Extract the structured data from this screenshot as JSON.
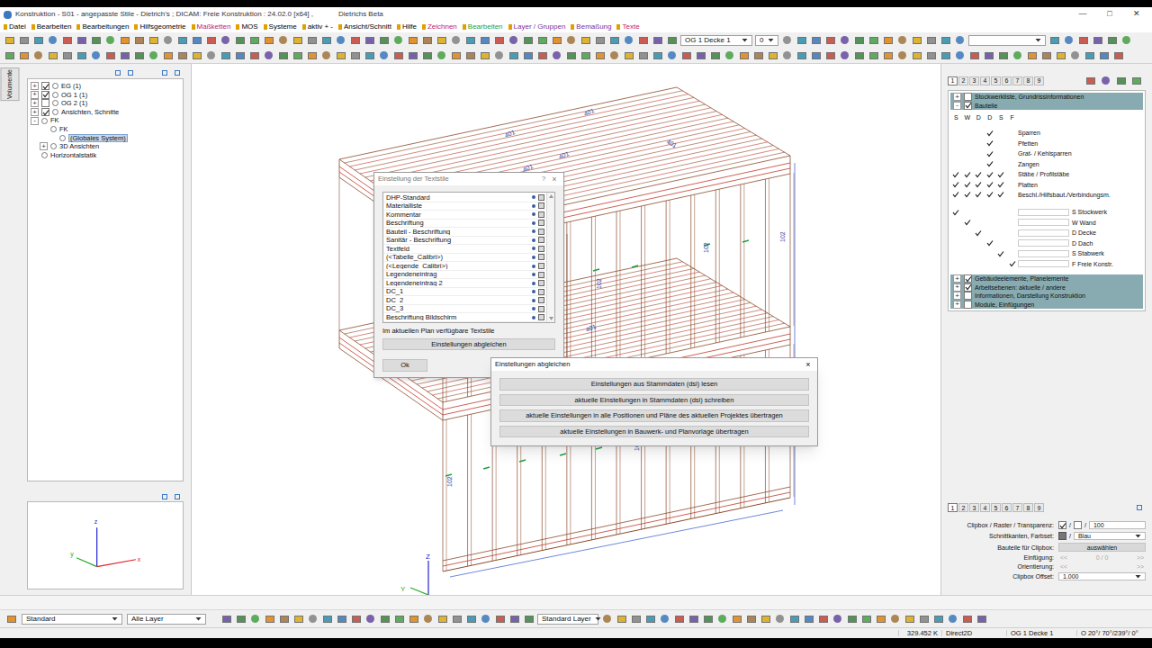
{
  "window": {
    "title": "Konstruktion - S01 - angepasste Stile - Dietrich's ; DICAM: Freie Konstruktion : 24.02.0 [x64] ,",
    "subtitle": "Dietrichs Beta",
    "controls": [
      "—",
      "□",
      "✕"
    ]
  },
  "menu": [
    {
      "label": "Datei",
      "color": "#000000"
    },
    {
      "label": "Bearbeiten",
      "color": "#000000"
    },
    {
      "label": "Bearbeitungen",
      "color": "#000000"
    },
    {
      "label": "Hilfsgeometrie",
      "color": "#000000"
    },
    {
      "label": "Maßketten",
      "color": "#c0186a"
    },
    {
      "label": "MOS",
      "color": "#000000"
    },
    {
      "label": "Systeme",
      "color": "#000000"
    },
    {
      "label": "aktiv + -",
      "color": "#000000"
    },
    {
      "label": "Ansicht/Schnitt",
      "color": "#000000"
    },
    {
      "label": "Hilfe",
      "color": "#000000"
    },
    {
      "label": "Zeichnen",
      "color": "#c0186a"
    },
    {
      "label": "Bearbeiten",
      "color": "#1a9e3a"
    },
    {
      "label": "Layer / Gruppen",
      "color": "#7b2fa0"
    },
    {
      "label": "Bemaßung",
      "color": "#7b2fa0"
    },
    {
      "label": "Texte",
      "color": "#c0186a"
    }
  ],
  "toolbar": {
    "floor_select": "OG 1 Decke 1",
    "floor_index": "0"
  },
  "left_panel": {
    "tab": "Volumente",
    "tree": [
      {
        "label": "EG (1)",
        "depth": 0,
        "expander": "+",
        "has_checkbox": true,
        "checked": true,
        "selected": false
      },
      {
        "label": "OG 1 (1)",
        "depth": 0,
        "expander": "+",
        "has_checkbox": true,
        "checked": true,
        "selected": false
      },
      {
        "label": "OG 2 (1)",
        "depth": 0,
        "expander": "+",
        "has_checkbox": true,
        "checked": false,
        "selected": false
      },
      {
        "label": "Ansichten, Schnitte",
        "depth": 0,
        "expander": "+",
        "has_checkbox": true,
        "checked": true,
        "selected": false
      },
      {
        "label": "FK",
        "depth": 0,
        "expander": "-",
        "has_checkbox": false,
        "checked": false,
        "selected": false
      },
      {
        "label": "FK",
        "depth": 1,
        "expander": "",
        "has_checkbox": false,
        "checked": false,
        "selected": false
      },
      {
        "label": "(Globales System)",
        "depth": 2,
        "expander": "",
        "has_checkbox": false,
        "checked": false,
        "selected": true
      },
      {
        "label": "3D Ansichten",
        "depth": 1,
        "expander": "+",
        "has_checkbox": false,
        "checked": false,
        "selected": false
      },
      {
        "label": "Horizontalstatik",
        "depth": 0,
        "expander": "",
        "has_checkbox": false,
        "checked": false,
        "selected": false
      }
    ],
    "axes": [
      "z",
      "y",
      "x"
    ]
  },
  "canvas": {
    "labels": [
      "401",
      "401",
      "401",
      "401",
      "401",
      "102",
      "102",
      "102",
      "401",
      "102",
      "102",
      "102"
    ],
    "axes": [
      "Z",
      "Y"
    ]
  },
  "textstyle_dialog": {
    "title": "Einstellung der Textstile",
    "help": "?",
    "close": "×",
    "styles": [
      "DHP-Standard",
      "Materialliste",
      "Kommentar",
      "Beschriftung",
      "Bauteil - Beschriftung",
      "Sanitär - Beschriftung",
      "Textfeld",
      "(<Tabelle_Calibri>)",
      "(<Legende_Calibri>)",
      "Legendeneintrag",
      "Legendeneintrag 2",
      "DC_1",
      "DC_2",
      "DC_3",
      "Beschriftung Bildschirm"
    ],
    "caption": "Im aktuellen Plan verfügbare Textstile",
    "sync_button": "Einstellungen abgleichen",
    "ok_button": "Ok"
  },
  "sync_dialog": {
    "title": "Einstellungen abgleichen",
    "close": "×",
    "buttons": [
      "Einstellungen aus Stammdaten (dsi) lesen",
      "aktuelle Einstellungen in Stammdaten (dsi) schreiben",
      "aktuelle Einstellungen in alle Positionen und Pläne des aktuellen Projektes übertragen",
      "aktuelle Einstellungen in Bauwerk- und Planvorlage übertragen"
    ]
  },
  "right_panel": {
    "tabs": [
      {
        "label": "1",
        "selected": true
      },
      {
        "label": "2",
        "selected": false
      },
      {
        "label": "3",
        "selected": false
      },
      {
        "label": "4",
        "selected": false
      },
      {
        "label": "5",
        "selected": false
      },
      {
        "label": "6",
        "selected": false
      },
      {
        "label": "7",
        "selected": false
      },
      {
        "label": "8",
        "selected": false
      },
      {
        "label": "9",
        "selected": false
      }
    ],
    "top_groups": [
      {
        "label": "Stockwerkliste, Grundrissinformationen",
        "expander": "+",
        "checked": false
      },
      {
        "label": "Bauteile",
        "expander": "-",
        "checked": true
      }
    ],
    "columns": [
      "S",
      "W",
      "D",
      "D",
      "S",
      "F"
    ],
    "parts": [
      {
        "label": "Sparren",
        "checks": [
          false,
          false,
          false,
          true,
          false,
          false
        ]
      },
      {
        "label": "Pfetten",
        "checks": [
          false,
          false,
          false,
          true,
          false,
          false
        ]
      },
      {
        "label": "Grat- / Kehlsparren",
        "checks": [
          false,
          false,
          false,
          true,
          false,
          false
        ]
      },
      {
        "label": "Zangen",
        "checks": [
          false,
          false,
          false,
          true,
          false,
          false
        ]
      },
      {
        "label": "Stäbe / Profilstäbe",
        "checks": [
          true,
          true,
          true,
          true,
          true,
          false
        ]
      },
      {
        "label": "Platten",
        "checks": [
          true,
          true,
          true,
          true,
          true,
          false
        ]
      },
      {
        "label": "Beschl./Hilfsbaut./Verbindungsm.",
        "checks": [
          true,
          true,
          true,
          true,
          true,
          false
        ]
      }
    ],
    "systems": [
      {
        "label": "S Stockwerk",
        "checks": [
          true,
          false,
          false,
          false,
          false,
          false
        ]
      },
      {
        "label": "W Wand",
        "checks": [
          false,
          true,
          false,
          false,
          false,
          false
        ]
      },
      {
        "label": "D Decke",
        "checks": [
          false,
          false,
          true,
          false,
          false,
          false
        ]
      },
      {
        "label": "D Dach",
        "checks": [
          false,
          false,
          false,
          true,
          false,
          false
        ]
      },
      {
        "label": "S Stabwerk",
        "checks": [
          false,
          false,
          false,
          false,
          true,
          false
        ]
      },
      {
        "label": "F Freie Konstr.",
        "checks": [
          false,
          false,
          false,
          false,
          false,
          true
        ]
      }
    ],
    "bottom_groups": [
      {
        "label": "Gebäudeelemente, Planelemente",
        "expander": "+",
        "checked": true
      },
      {
        "label": "Arbeitsebenen: aktuelle / andere",
        "expander": "+",
        "checked": true
      },
      {
        "label": "Informationen, Darstellung Konstruktion",
        "expander": "+",
        "checked": false
      },
      {
        "label": "Module, Einfügungen",
        "expander": "+",
        "checked": false
      }
    ],
    "prop_tabs": [
      {
        "label": "1",
        "selected": true
      },
      {
        "label": "2",
        "selected": false
      },
      {
        "label": "3",
        "selected": false
      },
      {
        "label": "4",
        "selected": false
      },
      {
        "label": "5",
        "selected": false
      },
      {
        "label": "6",
        "selected": false
      },
      {
        "label": "7",
        "selected": false
      },
      {
        "label": "8",
        "selected": false
      },
      {
        "label": "9",
        "selected": false
      }
    ],
    "props": {
      "clipbox_label": "Clipbox / Raster / Transparenz:",
      "clipbox_checked": true,
      "raster_checked": false,
      "separator": "/",
      "transparency": "100",
      "edges_label": "Schnittkanten, Farbset:",
      "colorset": "Blau",
      "parts_label": "Bauteile für Clipbox:",
      "parts_button": "auswählen",
      "insert_label": "Einfügung:",
      "insert_prev": "<<",
      "insert_value": "0 / 0",
      "insert_next": ">>",
      "orient_label": "Orientierung:",
      "orient_prev": "<<",
      "orient_next": ">>",
      "offset_label": "Clipbox Offset:",
      "offset_value": "1.000"
    }
  },
  "bottom_toolbar": {
    "style": "Standard",
    "layers": "Alle Layer",
    "layer": "Standard Layer"
  },
  "status_bar": {
    "memory": "329.452 K",
    "renderer": "Direct2D",
    "level": "OG 1 Decke 1",
    "orientation": "O 20°/ 70°/239°/ 0°"
  }
}
